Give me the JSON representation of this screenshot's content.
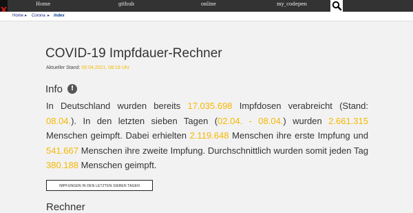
{
  "nav": {
    "close": "X",
    "items": [
      "Home",
      "github",
      "online",
      "my_codepen"
    ]
  },
  "breadcrumb": {
    "items": [
      "Home",
      "Corona",
      "Index"
    ],
    "separator": "▸"
  },
  "title": "COVID-19 Impfdauer-Rechner",
  "stand": {
    "label": "Aktueller Stand:",
    "value": "09.04.2021, 08:19 Uhr"
  },
  "info": {
    "heading": "Info",
    "icon": "!"
  },
  "paragraph": {
    "t1": "In Deutschland wurden bereits ",
    "v1": "17.035.698",
    "t2": " Impfdosen verabreicht (Stand: ",
    "v2": "08.04.",
    "t3": "). In den letzten sieben Tagen (",
    "v3": "02.04. - 08.04.",
    "t4": ") wurden ",
    "v4": "2.661.315",
    "t5": " Menschen geimpft. Dabei erhielten ",
    "v5": "2.119.648",
    "t6": " Menschen ihre erste Impfung und ",
    "v6": "541.667",
    "t7": " Menschen ihre zweite Impfung. Durchschnittlich wurden somit jeden Tag ",
    "v7": "380.188",
    "t8": " Menschen geimpft."
  },
  "button": "IMPFUNGEN IN DEN LETZTEN SIEBEN TAGEN",
  "next_heading": "Rechner",
  "colors": {
    "accent": "#f5b800",
    "nav_bg": "#333333"
  }
}
